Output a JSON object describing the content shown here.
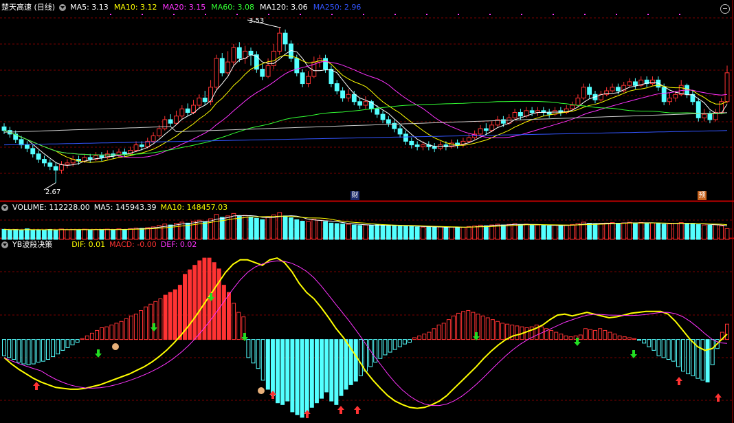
{
  "main_panel": {
    "title": "楚天高速 (日线)",
    "ma_legend": [
      {
        "label": "MA5: 3.13",
        "color": "#ffffff"
      },
      {
        "label": "MA10: 3.12",
        "color": "#ffff00"
      },
      {
        "label": "MA20: 3.15",
        "color": "#ff33ff"
      },
      {
        "label": "MA60: 3.08",
        "color": "#33ff33"
      },
      {
        "label": "MA120: 3.06",
        "color": "#ffffff"
      },
      {
        "label": "MA250: 2.96",
        "color": "#3355ff"
      }
    ],
    "high_label": "3.53",
    "low_label": "2.67",
    "markers": [
      {
        "text": "财"
      },
      {
        "text": "预"
      }
    ]
  },
  "volume_panel": {
    "title": "VOLUME: 112228.00",
    "ma_legend": [
      {
        "label": "MA5: 145943.39",
        "color": "#ffffff"
      },
      {
        "label": "MA10: 148457.03",
        "color": "#ffff00"
      }
    ]
  },
  "indicator_panel": {
    "title": "YB波段决策",
    "legend": [
      {
        "label": "DIF: 0.01",
        "color": "#ffff00"
      },
      {
        "label": "MACD: -0.00",
        "color": "#ff3333"
      },
      {
        "label": "DEF: 0.02",
        "color": "#ff33ff"
      }
    ]
  },
  "colors": {
    "up": "#ff3333",
    "down": "#54ffff",
    "grid": "#7a0000",
    "border": "#c00000"
  },
  "chart_data": [
    {
      "type": "candlestick",
      "title": "楚天高速 (日线)",
      "ylim": [
        2.6,
        3.6
      ],
      "annotations": [
        "3.53",
        "2.67",
        "财",
        "预"
      ],
      "candles": [
        [
          2.98,
          2.96,
          3.0,
          2.94
        ],
        [
          2.96,
          2.94,
          2.98,
          2.92
        ],
        [
          2.94,
          2.91,
          2.96,
          2.89
        ],
        [
          2.91,
          2.88,
          2.93,
          2.86
        ],
        [
          2.88,
          2.86,
          2.9,
          2.84
        ],
        [
          2.86,
          2.83,
          2.88,
          2.81
        ],
        [
          2.83,
          2.8,
          2.85,
          2.78
        ],
        [
          2.8,
          2.78,
          2.82,
          2.76
        ],
        [
          2.78,
          2.76,
          2.8,
          2.74
        ],
        [
          2.76,
          2.74,
          2.78,
          2.67
        ],
        [
          2.74,
          2.77,
          2.79,
          2.72
        ],
        [
          2.77,
          2.78,
          2.8,
          2.75
        ],
        [
          2.78,
          2.8,
          2.82,
          2.76
        ],
        [
          2.8,
          2.79,
          2.82,
          2.77
        ],
        [
          2.79,
          2.81,
          2.83,
          2.78
        ],
        [
          2.81,
          2.8,
          2.83,
          2.78
        ],
        [
          2.8,
          2.82,
          2.84,
          2.79
        ],
        [
          2.82,
          2.81,
          2.84,
          2.79
        ],
        [
          2.81,
          2.83,
          2.85,
          2.8
        ],
        [
          2.83,
          2.82,
          2.85,
          2.8
        ],
        [
          2.82,
          2.84,
          2.86,
          2.81
        ],
        [
          2.84,
          2.83,
          2.86,
          2.81
        ],
        [
          2.83,
          2.85,
          2.87,
          2.82
        ],
        [
          2.85,
          2.88,
          2.9,
          2.84
        ],
        [
          2.88,
          2.87,
          2.9,
          2.85
        ],
        [
          2.87,
          2.9,
          2.92,
          2.86
        ],
        [
          2.9,
          2.93,
          2.95,
          2.89
        ],
        [
          2.93,
          2.97,
          2.99,
          2.92
        ],
        [
          2.97,
          3.02,
          3.04,
          2.96
        ],
        [
          3.02,
          3.0,
          3.05,
          2.98
        ],
        [
          3.0,
          3.04,
          3.07,
          2.99
        ],
        [
          3.04,
          3.08,
          3.1,
          3.02
        ],
        [
          3.08,
          3.06,
          3.11,
          3.04
        ],
        [
          3.06,
          3.1,
          3.13,
          3.05
        ],
        [
          3.1,
          3.14,
          3.16,
          3.08
        ],
        [
          3.14,
          3.12,
          3.18,
          3.1
        ],
        [
          3.12,
          3.2,
          3.24,
          3.1
        ],
        [
          3.2,
          3.36,
          3.38,
          3.18
        ],
        [
          3.36,
          3.28,
          3.39,
          3.26
        ],
        [
          3.28,
          3.34,
          3.4,
          3.27
        ],
        [
          3.34,
          3.42,
          3.44,
          3.32
        ],
        [
          3.42,
          3.36,
          3.45,
          3.34
        ],
        [
          3.36,
          3.4,
          3.43,
          3.33
        ],
        [
          3.4,
          3.38,
          3.42,
          3.32
        ],
        [
          3.38,
          3.3,
          3.4,
          3.28
        ],
        [
          3.3,
          3.26,
          3.33,
          3.24
        ],
        [
          3.26,
          3.32,
          3.36,
          3.25
        ],
        [
          3.32,
          3.4,
          3.44,
          3.3
        ],
        [
          3.4,
          3.5,
          3.53,
          3.38
        ],
        [
          3.5,
          3.44,
          3.52,
          3.4
        ],
        [
          3.44,
          3.36,
          3.46,
          3.34
        ],
        [
          3.36,
          3.28,
          3.38,
          3.26
        ],
        [
          3.28,
          3.22,
          3.3,
          3.2
        ],
        [
          3.22,
          3.26,
          3.29,
          3.2
        ],
        [
          3.26,
          3.34,
          3.37,
          3.25
        ],
        [
          3.34,
          3.36,
          3.38,
          3.31
        ],
        [
          3.36,
          3.3,
          3.38,
          3.28
        ],
        [
          3.3,
          3.22,
          3.32,
          3.2
        ],
        [
          3.22,
          3.18,
          3.24,
          3.16
        ],
        [
          3.18,
          3.14,
          3.2,
          3.12
        ],
        [
          3.14,
          3.16,
          3.19,
          3.12
        ],
        [
          3.16,
          3.12,
          3.18,
          3.1
        ],
        [
          3.12,
          3.1,
          3.14,
          3.08
        ],
        [
          3.1,
          3.12,
          3.15,
          3.08
        ],
        [
          3.12,
          3.08,
          3.13,
          3.06
        ],
        [
          3.08,
          3.05,
          3.1,
          3.03
        ],
        [
          3.05,
          3.02,
          3.07,
          3.0
        ],
        [
          3.02,
          3.0,
          3.04,
          2.98
        ],
        [
          3.0,
          2.97,
          3.02,
          2.95
        ],
        [
          2.97,
          2.94,
          2.99,
          2.92
        ],
        [
          2.94,
          2.9,
          2.96,
          2.88
        ],
        [
          2.9,
          2.88,
          2.92,
          2.86
        ],
        [
          2.88,
          2.87,
          2.9,
          2.85
        ],
        [
          2.87,
          2.88,
          2.9,
          2.85
        ],
        [
          2.88,
          2.87,
          2.9,
          2.85
        ],
        [
          2.87,
          2.86,
          2.89,
          2.84
        ],
        [
          2.86,
          2.88,
          2.9,
          2.85
        ],
        [
          2.88,
          2.87,
          2.9,
          2.85
        ],
        [
          2.87,
          2.89,
          2.91,
          2.86
        ],
        [
          2.89,
          2.88,
          2.91,
          2.86
        ],
        [
          2.88,
          2.9,
          2.92,
          2.87
        ],
        [
          2.9,
          2.92,
          2.94,
          2.89
        ],
        [
          2.92,
          2.94,
          2.96,
          2.91
        ],
        [
          2.94,
          2.97,
          2.99,
          2.93
        ],
        [
          2.97,
          2.96,
          3.0,
          2.94
        ],
        [
          2.96,
          2.99,
          3.01,
          2.95
        ],
        [
          2.99,
          3.02,
          3.04,
          2.98
        ],
        [
          3.02,
          3.0,
          3.04,
          2.98
        ],
        [
          3.0,
          3.03,
          3.05,
          2.99
        ],
        [
          3.03,
          3.06,
          3.08,
          3.02
        ],
        [
          3.06,
          3.04,
          3.08,
          3.02
        ],
        [
          3.04,
          3.07,
          3.09,
          3.03
        ],
        [
          3.07,
          3.06,
          3.09,
          3.04
        ],
        [
          3.06,
          3.07,
          3.09,
          3.04
        ],
        [
          3.07,
          3.06,
          3.09,
          3.04
        ],
        [
          3.06,
          3.05,
          3.08,
          3.03
        ],
        [
          3.05,
          3.07,
          3.09,
          3.04
        ],
        [
          3.07,
          3.06,
          3.09,
          3.04
        ],
        [
          3.06,
          3.08,
          3.1,
          3.05
        ],
        [
          3.08,
          3.1,
          3.12,
          3.07
        ],
        [
          3.1,
          3.14,
          3.16,
          3.09
        ],
        [
          3.14,
          3.2,
          3.22,
          3.13
        ],
        [
          3.2,
          3.16,
          3.22,
          3.14
        ],
        [
          3.16,
          3.13,
          3.18,
          3.11
        ],
        [
          3.13,
          3.16,
          3.18,
          3.12
        ],
        [
          3.16,
          3.18,
          3.2,
          3.15
        ],
        [
          3.18,
          3.2,
          3.22,
          3.17
        ],
        [
          3.2,
          3.18,
          3.22,
          3.16
        ],
        [
          3.18,
          3.21,
          3.23,
          3.17
        ],
        [
          3.21,
          3.23,
          3.25,
          3.2
        ],
        [
          3.23,
          3.21,
          3.25,
          3.19
        ],
        [
          3.21,
          3.24,
          3.26,
          3.2
        ],
        [
          3.24,
          3.22,
          3.26,
          3.2
        ],
        [
          3.22,
          3.24,
          3.26,
          3.21
        ],
        [
          3.24,
          3.2,
          3.26,
          3.18
        ],
        [
          3.2,
          3.12,
          3.22,
          3.1
        ],
        [
          3.12,
          3.14,
          3.17,
          3.1
        ],
        [
          3.14,
          3.16,
          3.18,
          3.12
        ],
        [
          3.16,
          3.21,
          3.24,
          3.15
        ],
        [
          3.21,
          3.16,
          3.22,
          3.14
        ],
        [
          3.16,
          3.12,
          3.18,
          3.1
        ],
        [
          3.12,
          3.03,
          3.14,
          3.01
        ],
        [
          3.03,
          3.05,
          3.08,
          3.01
        ],
        [
          3.05,
          3.02,
          3.07,
          3.0
        ],
        [
          3.02,
          3.06,
          3.08,
          3.01
        ],
        [
          3.06,
          3.12,
          3.14,
          3.05
        ],
        [
          3.12,
          3.28,
          3.32,
          3.11
        ]
      ]
    },
    {
      "type": "bar",
      "title": "VOLUME",
      "values": [
        105000,
        98000,
        102000,
        95000,
        110000,
        96000,
        101000,
        99000,
        104000,
        97000,
        108000,
        100000,
        103000,
        98000,
        106000,
        99000,
        104000,
        101000,
        107000,
        100000,
        110000,
        102000,
        112000,
        118000,
        115000,
        122000,
        130000,
        145000,
        160000,
        150000,
        168000,
        180000,
        170000,
        190000,
        200000,
        185000,
        215000,
        260000,
        230000,
        245000,
        270000,
        240000,
        250000,
        235000,
        220000,
        205000,
        230000,
        255000,
        280000,
        245000,
        225000,
        205000,
        190000,
        185000,
        210000,
        200000,
        185000,
        170000,
        165000,
        160000,
        158000,
        150000,
        145000,
        150000,
        148000,
        152000,
        146000,
        140000,
        145000,
        138000,
        142000,
        135000,
        130000,
        128000,
        132000,
        126000,
        130000,
        124000,
        128000,
        122000,
        126000,
        134000,
        140000,
        148000,
        142000,
        150000,
        158000,
        150000,
        156000,
        164000,
        152000,
        160000,
        148000,
        150000,
        146000,
        142000,
        148000,
        144000,
        150000,
        155000,
        165000,
        180000,
        168000,
        160000,
        166000,
        170000,
        175000,
        168000,
        172000,
        178000,
        170000,
        176000,
        168000,
        172000,
        165000,
        158000,
        162000,
        168000,
        175000,
        168000,
        160000,
        155000,
        150000,
        148000,
        152000,
        140000,
        112228
      ],
      "ma": [
        {
          "name": "MA5",
          "last": 145943.39
        },
        {
          "name": "MA10",
          "last": 148457.03
        }
      ]
    },
    {
      "type": "bar",
      "title": "YB波段决策",
      "ylim": [
        -0.09,
        0.1
      ],
      "series": [
        {
          "name": "MACD",
          "values": [
            -0.018,
            -0.02,
            -0.022,
            -0.025,
            -0.027,
            -0.028,
            -0.027,
            -0.025,
            -0.024,
            -0.022,
            -0.019,
            -0.016,
            -0.012,
            -0.009,
            -0.006,
            -0.003,
            0.001,
            0.004,
            0.007,
            0.01,
            0.013,
            0.014,
            0.016,
            0.018,
            0.02,
            0.023,
            0.026,
            0.028,
            0.032,
            0.036,
            0.039,
            0.042,
            0.045,
            0.049,
            0.052,
            0.055,
            0.06,
            0.072,
            0.077,
            0.082,
            0.087,
            0.09,
            0.09,
            0.085,
            0.078,
            0.06,
            0.052,
            0.04,
            0.03,
            0.025,
            -0.02,
            -0.026,
            -0.032,
            -0.045,
            -0.055,
            -0.062,
            -0.07,
            -0.072,
            -0.068,
            -0.08,
            -0.083,
            -0.086,
            -0.08,
            -0.075,
            -0.07,
            -0.065,
            -0.058,
            -0.068,
            -0.072,
            -0.062,
            -0.055,
            -0.05,
            -0.046,
            -0.04,
            -0.035,
            -0.03,
            -0.025,
            -0.021,
            -0.017,
            -0.014,
            -0.011,
            -0.008,
            -0.005,
            -0.003,
            0.002,
            0.004,
            0.006,
            0.008,
            0.012,
            0.016,
            0.018,
            0.022,
            0.026,
            0.029,
            0.031,
            0.032,
            0.03,
            0.028,
            0.026,
            0.024,
            0.022,
            0.02,
            0.018,
            0.017,
            0.016,
            0.015,
            0.014,
            0.013,
            0.014,
            0.016,
            0.014,
            0.012,
            0.01,
            0.008,
            0.006,
            0.004,
            0.003,
            0.004,
            0.005,
            0.012,
            0.011,
            0.01,
            0.012,
            0.01,
            0.008,
            0.006,
            0.004,
            0.003,
            0.002,
            0.001,
            -0.001,
            -0.004,
            -0.008,
            -0.012,
            -0.018,
            -0.02,
            -0.022,
            -0.024,
            -0.03,
            -0.035,
            -0.038,
            -0.04,
            -0.043,
            -0.045,
            -0.047,
            -0.028,
            -0.01,
            0.008,
            0.017
          ]
        },
        {
          "name": "DIF",
          "values": [
            -0.02,
            -0.027,
            -0.033,
            -0.038,
            -0.043,
            -0.047,
            -0.05,
            -0.053,
            -0.054,
            -0.055,
            -0.055,
            -0.054,
            -0.052,
            -0.05,
            -0.047,
            -0.044,
            -0.041,
            -0.038,
            -0.034,
            -0.03,
            -0.025,
            -0.019,
            -0.012,
            -0.004,
            0.005,
            0.015,
            0.026,
            0.038,
            0.05,
            0.062,
            0.074,
            0.083,
            0.088,
            0.088,
            0.085,
            0.082,
            0.088,
            0.09,
            0.085,
            0.075,
            0.062,
            0.052,
            0.045,
            0.035,
            0.024,
            0.012,
            0.002,
            -0.01,
            -0.022,
            -0.035,
            -0.045,
            -0.054,
            -0.062,
            -0.068,
            -0.072,
            -0.075,
            -0.076,
            -0.075,
            -0.072,
            -0.068,
            -0.062,
            -0.054,
            -0.046,
            -0.038,
            -0.03,
            -0.021,
            -0.013,
            -0.006,
            0.0,
            0.004,
            0.006,
            0.009,
            0.012,
            0.016,
            0.022,
            0.027,
            0.028,
            0.026,
            0.028,
            0.03,
            0.028,
            0.026,
            0.024,
            0.025,
            0.027,
            0.029,
            0.03,
            0.031,
            0.031,
            0.031,
            0.028,
            0.02,
            0.01,
            0.0,
            -0.008,
            -0.012,
            -0.01,
            -0.002,
            0.006
          ]
        }
      ]
    }
  ]
}
